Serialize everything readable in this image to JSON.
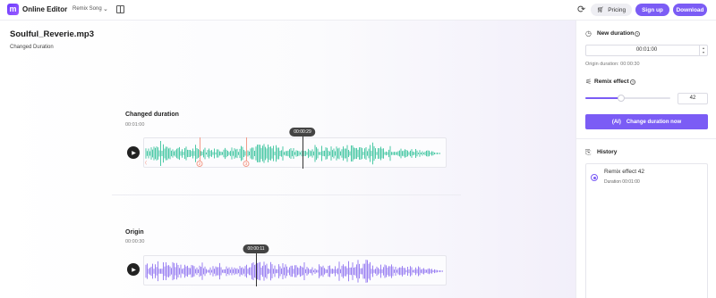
{
  "topbar": {
    "logo_letter": "m",
    "app_name": "Online Editor",
    "mode": "Remix Song",
    "pricing_label": "Pricing",
    "signup_label": "Sign up",
    "download_label": "Download"
  },
  "main": {
    "file_name": "Soulful_Reverie.mp3",
    "subtitle": "Changed Duration",
    "changed": {
      "label": "Changed duration",
      "duration": "00:01:00",
      "playhead_time": "00:00:29",
      "markers": [
        "1",
        "2",
        "3"
      ],
      "wave_color": "#4cc9a6"
    },
    "origin": {
      "label": "Origin",
      "duration": "00:00:30",
      "playhead_time": "00:00:11",
      "wave_color": "#9b82f2"
    }
  },
  "panel": {
    "new_duration_label": "New duration",
    "duration_value": "00:01:00",
    "origin_duration": "Origin duration: 00:00:30",
    "remix_effect_label": "Remix effect",
    "remix_value": "42",
    "remix_fraction": 0.42,
    "change_button": "Change duration now",
    "change_button_icon": "(AI)",
    "history_label": "History",
    "history_items": [
      {
        "title": "Remix effect 42",
        "duration": "Duration 00:01:00"
      }
    ]
  },
  "colors": {
    "accent": "#7b5cf5",
    "changed_wave": "#4cc9a6",
    "origin_wave": "#9b82f2",
    "marker": "#f07a66"
  }
}
